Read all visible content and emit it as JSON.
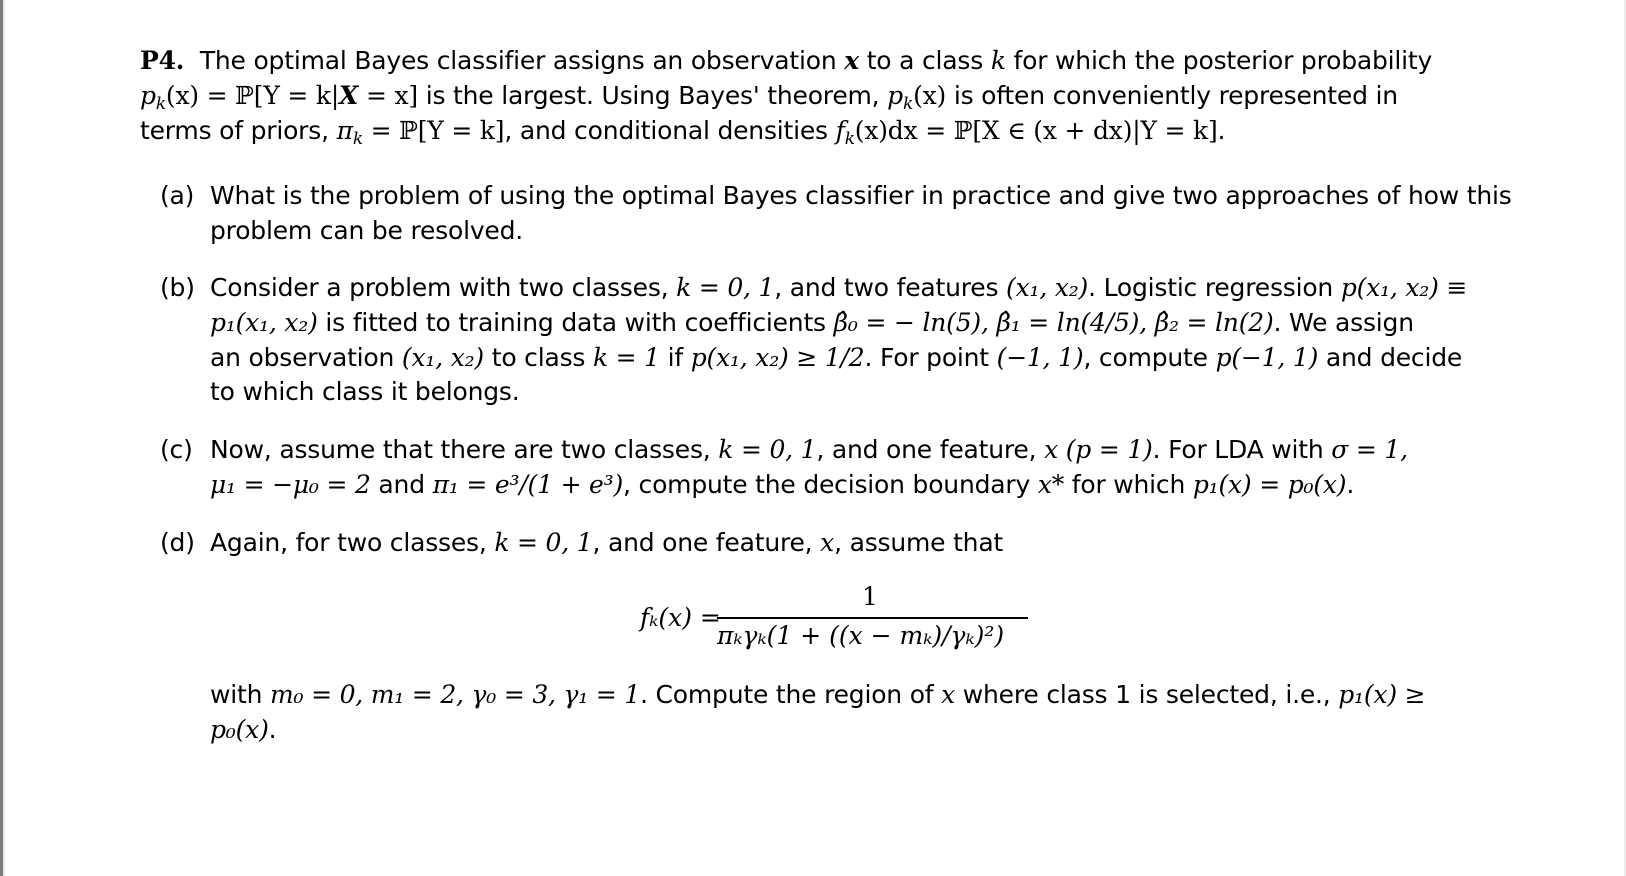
{
  "problem": {
    "number": "P4.",
    "intro": [
      {
        "segments": [
          "The optimal Bayes classifier assigns an observation ",
          "x",
          " to a class ",
          "k",
          " for which the posterior probability"
        ]
      },
      {
        "segments": [
          "p",
          "k",
          "(x) = ℙ[Y = k|",
          "X",
          " = x]",
          " is the largest.  Using Bayes' theorem, ",
          "p",
          "k",
          "(x)",
          " is often conveniently represented in"
        ]
      },
      {
        "segments": [
          "terms of priors, ",
          "π",
          "k",
          " = ℙ[Y = k]",
          ", and conditional densities ",
          "f",
          "k",
          "(x)dx = ℙ[X ∈ (x + dx)|Y = k]",
          "."
        ]
      }
    ]
  },
  "parts": {
    "a": {
      "label": "(a)",
      "lines": [
        "What is the problem of using the optimal Bayes classifier in practice and give two approaches of how this",
        "problem can be resolved."
      ]
    },
    "b": {
      "label": "(b)",
      "line1_text": "Consider a problem with two classes, ",
      "line1_math1": "k = 0, 1",
      "line1_text2": ", and two features ",
      "line1_math2": "(x₁, x₂)",
      "line1_text3": ".  Logistic regression ",
      "line1_math3": "p(x₁, x₂) ≡",
      "line2_math1": "p₁(x₁, x₂)",
      "line2_text1": " is fitted to training data with coefficients ",
      "line2_math2": "β̂₀ = − ln(5), β̂₁ = ln(4/5), β̂₂ = ln(2)",
      "line2_text2": ".  We assign",
      "line3_text1": "an observation ",
      "line3_math1": "(x₁, x₂)",
      "line3_text2": " to class ",
      "line3_math2": "k = 1",
      "line3_text3": " if ",
      "line3_math3": "p(x₁, x₂) ≥ 1/2",
      "line3_text4": ".  For point ",
      "line3_math4": "(−1, 1)",
      "line3_text5": ", compute ",
      "line3_math5": "p(−1, 1)",
      "line3_text6": " and decide",
      "line4_text": "to which class it belongs."
    },
    "c": {
      "label": "(c)",
      "line1_text1": "Now, assume that there are two classes, ",
      "line1_math1": "k = 0, 1",
      "line1_text2": ", and one feature, ",
      "line1_math2": "x (p = 1)",
      "line1_text3": ".  For LDA with ",
      "line1_math3": "σ = 1,",
      "line2_math1": "μ₁ = −μ₀ = 2",
      "line2_text1": " and ",
      "line2_math2": "π₁ = e³/(1 + e³)",
      "line2_text2": ", compute the decision boundary ",
      "line2_math3": "x*",
      "line2_text3": " for which ",
      "line2_math4": "p₁(x) = p₀(x)",
      "line2_text4": "."
    },
    "d": {
      "label": "(d)",
      "line1_text1": "Again, for two classes, ",
      "line1_math1": "k = 0, 1",
      "line1_text2": ", and one feature, ",
      "line1_math2": "x",
      "line1_text3": ", assume that",
      "formula_lhs": "fₖ(x) =",
      "formula_numerator": "1",
      "formula_denominator": "πₖγₖ(1 + ((x − mₖ)/γₖ)²)",
      "line2_text1": "with ",
      "line2_math1": "m₀ = 0, m₁ = 2, γ₀ = 3, γ₁ = 1",
      "line2_text2": ".  Compute the region of ",
      "line2_math2": "x",
      "line2_text3": " where class 1 is selected, i.e., ",
      "line2_math3": "p₁(x) ≥",
      "line3_math1": "p₀(x)",
      "line3_text1": "."
    }
  }
}
